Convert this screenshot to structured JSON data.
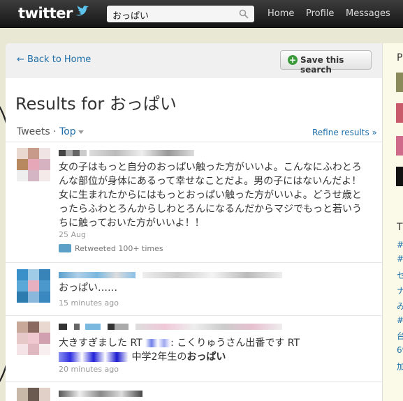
{
  "topbar": {
    "logo": "twitter",
    "search_value": "おっぱい",
    "nav": [
      "Home",
      "Profile",
      "Messages"
    ]
  },
  "header": {
    "back_link": "← Back to Home",
    "save_label": "Save this search"
  },
  "results": {
    "title": "Results for おっぱい",
    "tweets_label": "Tweets ·",
    "top_label": "Top",
    "refine_label": "Refine results »"
  },
  "tweets": [
    {
      "text": "女の子はもっと自分のおっぱい触った方がいいよ。こんなにふわとろんな部位が身体にあるって幸せなことだよ。男の子にはないんだよ！女に生まれたからにはもっとおっぱい触った方がいいよ。どうせ歳とったらふわとろんからしわとろんになるんだからマジでもっと若いうちに触っておいた方がいいよ！！",
      "time": "25 Aug",
      "retweet": "Retweeted 100+ times"
    },
    {
      "text": "おっぱい……",
      "time": "15 minutes ago"
    },
    {
      "text_a": "大きすぎました RT",
      "text_b": ": こくりゅうさん出番です RT",
      "text_c": "中学2年生の",
      "text_bold": "おっぱい",
      "time": "20 minutes ago"
    }
  ],
  "sidebar": {
    "heading_initial": "P",
    "trends_initial": "T",
    "items": [
      "#",
      "#",
      "セ",
      "ナ",
      "み",
      "#e",
      "台",
      "69",
      "加"
    ]
  },
  "colors": {
    "link": "#1d6ea8",
    "topbar": "#1a1a1a",
    "retweet_icon": "#5ca0c8"
  }
}
